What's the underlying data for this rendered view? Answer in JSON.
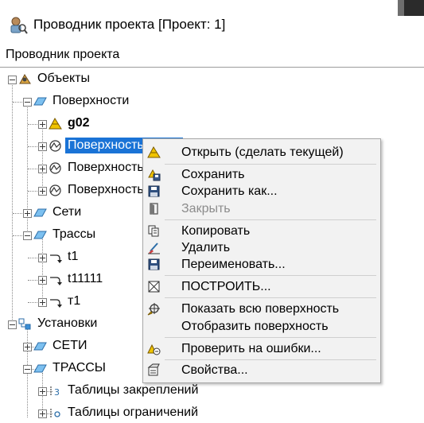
{
  "window": {
    "title": "Проводник проекта [Проект: 1]"
  },
  "panel": {
    "header": "Проводник проекта"
  },
  "tree": {
    "objects": "Объекты",
    "surfaces": "Поверхности",
    "surface_items": [
      "g02",
      "Поверхность",
      "Поверхность",
      "Поверхность"
    ],
    "networks": "Сети",
    "alignments": "Трассы",
    "alignment_items": [
      "t1",
      "t11111",
      "т1"
    ],
    "settings": "Установки",
    "settings_networks": "СЕТИ",
    "settings_alignments": "ТРАССЫ",
    "anchor_tables": "Таблицы закреплений",
    "constraint_tables": "Таблицы ограничений"
  },
  "context_menu": {
    "open_current": "Открыть (сделать текущей)",
    "save": "Сохранить",
    "save_as": "Сохранить как...",
    "close": "Закрыть",
    "copy": "Копировать",
    "delete": "Удалить",
    "rename": "Переименовать...",
    "build": "ПОСТРОИТЬ...",
    "show_all": "Показать всю поверхность",
    "display": "Отобразить поверхность",
    "check_errors": "Проверить на ошибки...",
    "properties": "Свойства..."
  },
  "colors": {
    "selection": "#1a73d6",
    "menu_bg": "#f2f2f2",
    "folder_blue": "#3b8fd6",
    "surface_yellow": "#e8b400"
  }
}
